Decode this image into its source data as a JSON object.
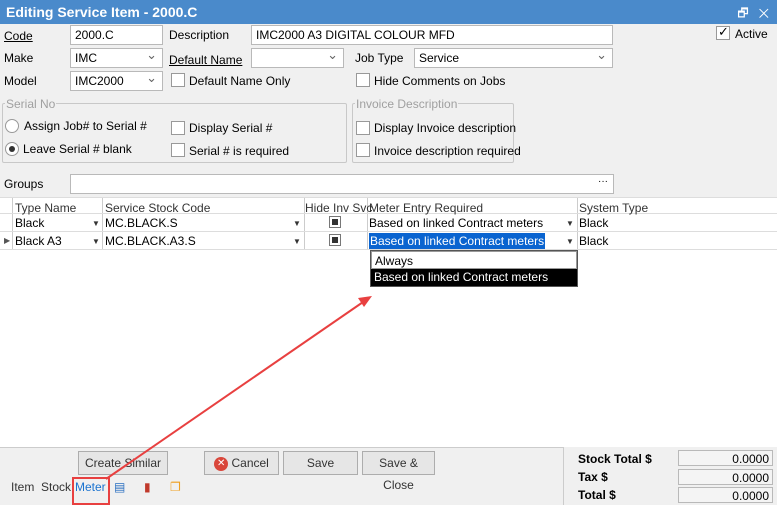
{
  "window": {
    "title": "Editing Service Item - 2000.C",
    "restore_icon": "restore-icon",
    "close_icon": "close-icon"
  },
  "form": {
    "code_label": "Code",
    "code_value": "2000.C",
    "description_label": "Description",
    "description_value": "IMC2000 A3 DIGITAL COLOUR MFD",
    "active_label": "Active",
    "active_checked": true,
    "make_label": "Make",
    "make_value": "IMC",
    "default_name_label": "Default Name",
    "default_name_value": "",
    "job_type_label": "Job Type",
    "job_type_value": "Service",
    "model_label": "Model",
    "model_value": "IMC2000",
    "default_name_only_label": "Default Name Only",
    "hide_comments_label": "Hide Comments on Jobs",
    "serial_group": "Serial No",
    "assign_job_label": "Assign Job# to Serial #",
    "leave_blank_label": "Leave Serial # blank",
    "selected_serial_option": "Leave Serial # blank",
    "display_serial_label": "Display Serial #",
    "serial_required_label": "Serial # is required",
    "invoice_group": "Invoice Description",
    "display_invoice_label": "Display Invoice description",
    "invoice_required_label": "Invoice description required",
    "groups_label": "Groups",
    "groups_value": "",
    "groups_button": "···"
  },
  "grid": {
    "columns": [
      "Type Name",
      "Service Stock Code",
      "Hide Inv Svc",
      "Meter Entry Required",
      "System Type"
    ],
    "rows": [
      {
        "type_name": "Black",
        "stock_code": "MC.BLACK.S",
        "hide_inv": true,
        "meter_entry": "Based on linked Contract meters",
        "system_type": "Black"
      },
      {
        "type_name": "Black A3",
        "stock_code": "MC.BLACK.A3.S",
        "hide_inv": true,
        "meter_entry": "Based on linked Contract meters",
        "system_type": "Black"
      }
    ],
    "dropdown_options": [
      "Always",
      "Based on linked Contract meters"
    ],
    "dropdown_selected": "Based on linked Contract meters"
  },
  "footer": {
    "create_similar": "Create Similar",
    "cancel": "Cancel",
    "save": "Save",
    "save_close": "Save & Close",
    "tabs": [
      "Item",
      "Stock",
      "Meter"
    ],
    "active_tab": "Meter",
    "stock_total_label": "Stock Total $",
    "stock_total": "0.0000",
    "tax_label": "Tax $",
    "tax": "0.0000",
    "total_label": "Total $",
    "total": "0.0000"
  },
  "colors": {
    "title_bar": "#4a8acb",
    "selection": "#0a64d0",
    "annotation": "#e84040",
    "active_tab": "#1a73d0"
  }
}
